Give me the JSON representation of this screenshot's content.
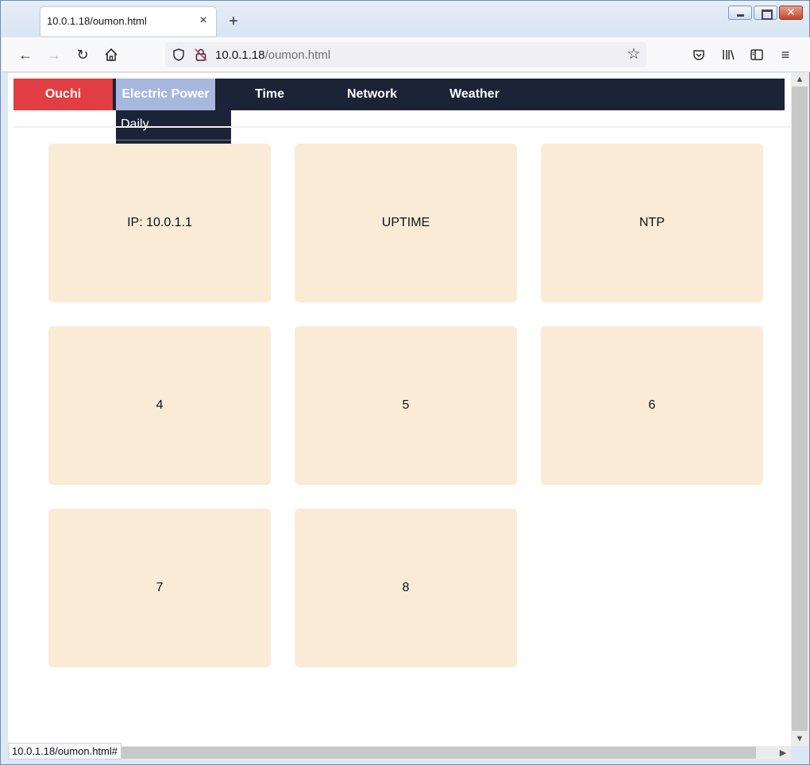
{
  "browser": {
    "tab_title": "10.0.1.18/oumon.html",
    "tab_close": "×",
    "new_tab": "+",
    "url_host": "10.0.1.18",
    "url_path": "/oumon.html",
    "status_url": "10.0.1.18/oumon.html#"
  },
  "menu": {
    "items": [
      {
        "label": "Ouchi",
        "color": "#e03e43"
      },
      {
        "label": "Electric Power",
        "color": "#a7b7de"
      },
      {
        "label": "Time"
      },
      {
        "label": "Network"
      },
      {
        "label": "Weather"
      }
    ],
    "background": "#1a2436",
    "dropdown": {
      "items": [
        {
          "label": "Daily"
        }
      ]
    }
  },
  "cards": [
    {
      "label": "IP: 10.0.1.1"
    },
    {
      "label": "UPTIME"
    },
    {
      "label": "NTP"
    },
    {
      "label": "4"
    },
    {
      "label": "5"
    },
    {
      "label": "6"
    },
    {
      "label": "7"
    },
    {
      "label": "8"
    }
  ],
  "card_color": "#faebd7"
}
